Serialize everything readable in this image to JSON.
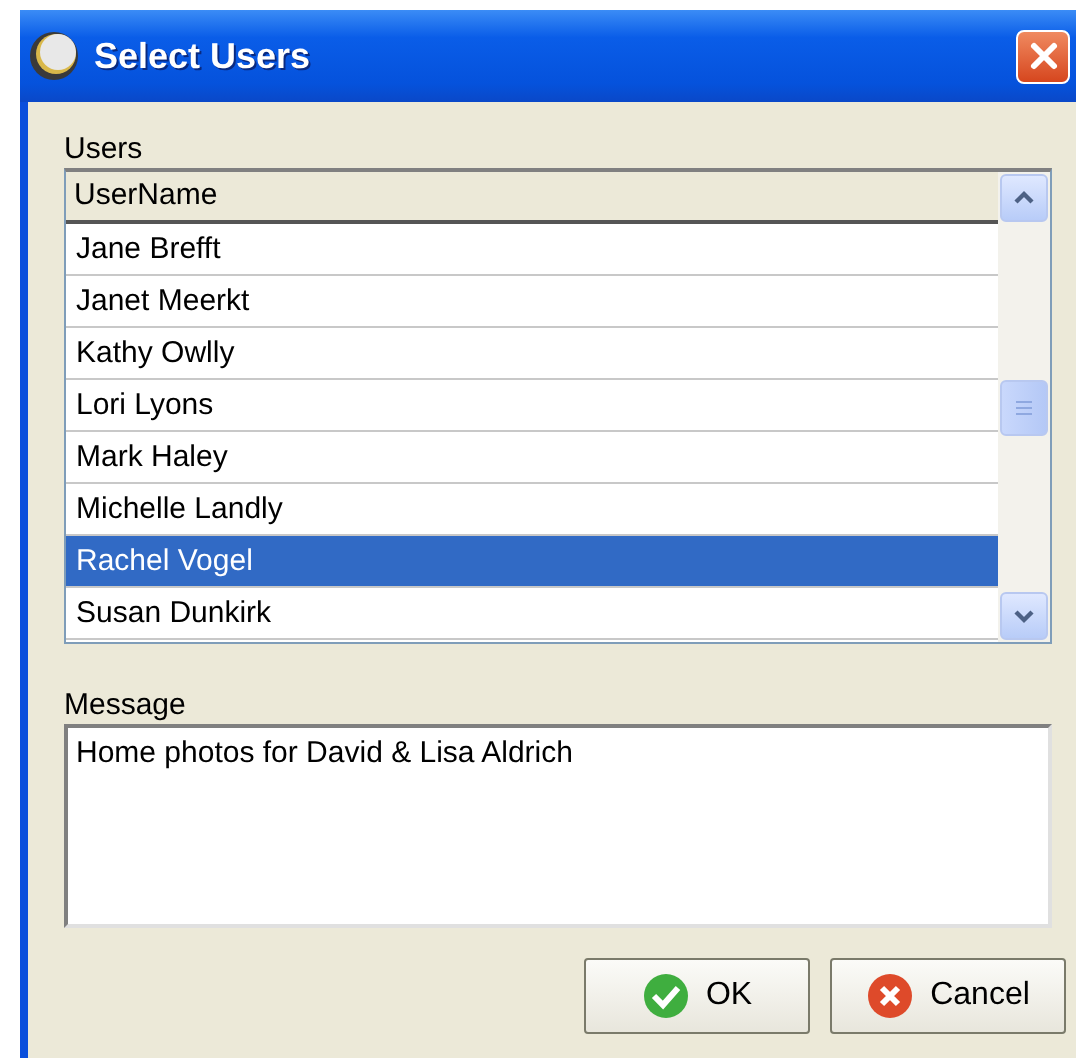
{
  "window": {
    "title": "Select Users"
  },
  "users": {
    "label": "Users",
    "columns": [
      "UserName"
    ],
    "rows": [
      {
        "name": "Jane Brefft",
        "selected": false
      },
      {
        "name": "Janet Meerkt",
        "selected": false
      },
      {
        "name": "Kathy Owlly",
        "selected": false
      },
      {
        "name": "Lori Lyons",
        "selected": false
      },
      {
        "name": "Mark Haley",
        "selected": false
      },
      {
        "name": "Michelle Landly",
        "selected": false
      },
      {
        "name": "Rachel Vogel",
        "selected": true
      },
      {
        "name": "Susan Dunkirk",
        "selected": false
      }
    ]
  },
  "message": {
    "label": "Message",
    "value": "Home photos for David & Lisa Aldrich"
  },
  "buttons": [
    {
      "kind": "ok",
      "label": "OK"
    },
    {
      "kind": "cancel",
      "label": "Cancel"
    }
  ]
}
